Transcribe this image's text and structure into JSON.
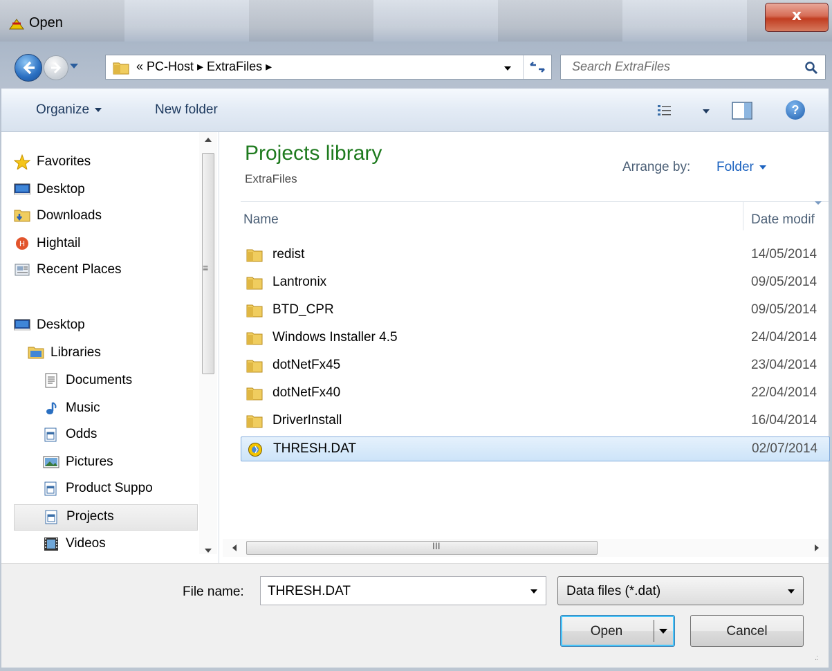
{
  "window": {
    "title": "Open",
    "close_label": "x"
  },
  "address": {
    "breadcrumb": "« PC-Host ▸ ExtraFiles ▸",
    "search_placeholder": "Search ExtraFiles"
  },
  "toolbar": {
    "organize": "Organize",
    "new_folder": "New folder"
  },
  "nav": {
    "items": [
      {
        "label": "Favorites",
        "icon": "star-icon"
      },
      {
        "label": "Desktop",
        "icon": "desktop-icon"
      },
      {
        "label": "Downloads",
        "icon": "downloads-icon"
      },
      {
        "label": "Hightail",
        "icon": "hightail-icon"
      },
      {
        "label": "Recent Places",
        "icon": "recent-places-icon"
      },
      {
        "label": "Desktop",
        "icon": "desktop-icon"
      },
      {
        "label": "Libraries",
        "icon": "libraries-icon"
      },
      {
        "label": "Documents",
        "icon": "documents-icon"
      },
      {
        "label": "Music",
        "icon": "music-icon"
      },
      {
        "label": "Odds",
        "icon": "library-icon"
      },
      {
        "label": "Pictures",
        "icon": "pictures-icon"
      },
      {
        "label": "Product Suppo",
        "icon": "library-icon"
      },
      {
        "label": "Projects",
        "icon": "library-icon"
      },
      {
        "label": "Videos",
        "icon": "videos-icon"
      }
    ],
    "selected": "Projects"
  },
  "library": {
    "title": "Projects library",
    "subtitle": "ExtraFiles",
    "arrange_label": "Arrange by:",
    "arrange_value": "Folder"
  },
  "columns": {
    "name": "Name",
    "date": "Date modif"
  },
  "files": [
    {
      "name": "redist",
      "date": "14/05/2014",
      "type": "folder"
    },
    {
      "name": "Lantronix",
      "date": "09/05/2014",
      "type": "folder"
    },
    {
      "name": "BTD_CPR",
      "date": "09/05/2014",
      "type": "folder"
    },
    {
      "name": "Windows Installer 4.5",
      "date": "24/04/2014",
      "type": "folder"
    },
    {
      "name": "dotNetFx45",
      "date": "23/04/2014",
      "type": "folder"
    },
    {
      "name": "dotNetFx40",
      "date": "22/04/2014",
      "type": "folder"
    },
    {
      "name": "DriverInstall",
      "date": "16/04/2014",
      "type": "folder"
    },
    {
      "name": "THRESH.DAT",
      "date": "02/07/2014",
      "type": "dat-file",
      "selected": true
    }
  ],
  "footer": {
    "file_name_label": "File name:",
    "file_name_value": "THRESH.DAT",
    "file_type_value": "Data files (*.dat)",
    "open_label": "Open",
    "cancel_label": "Cancel"
  },
  "colors": {
    "accent": "#1c63c0",
    "library_title": "#1e7a1e",
    "selection": "#cde4f9"
  }
}
